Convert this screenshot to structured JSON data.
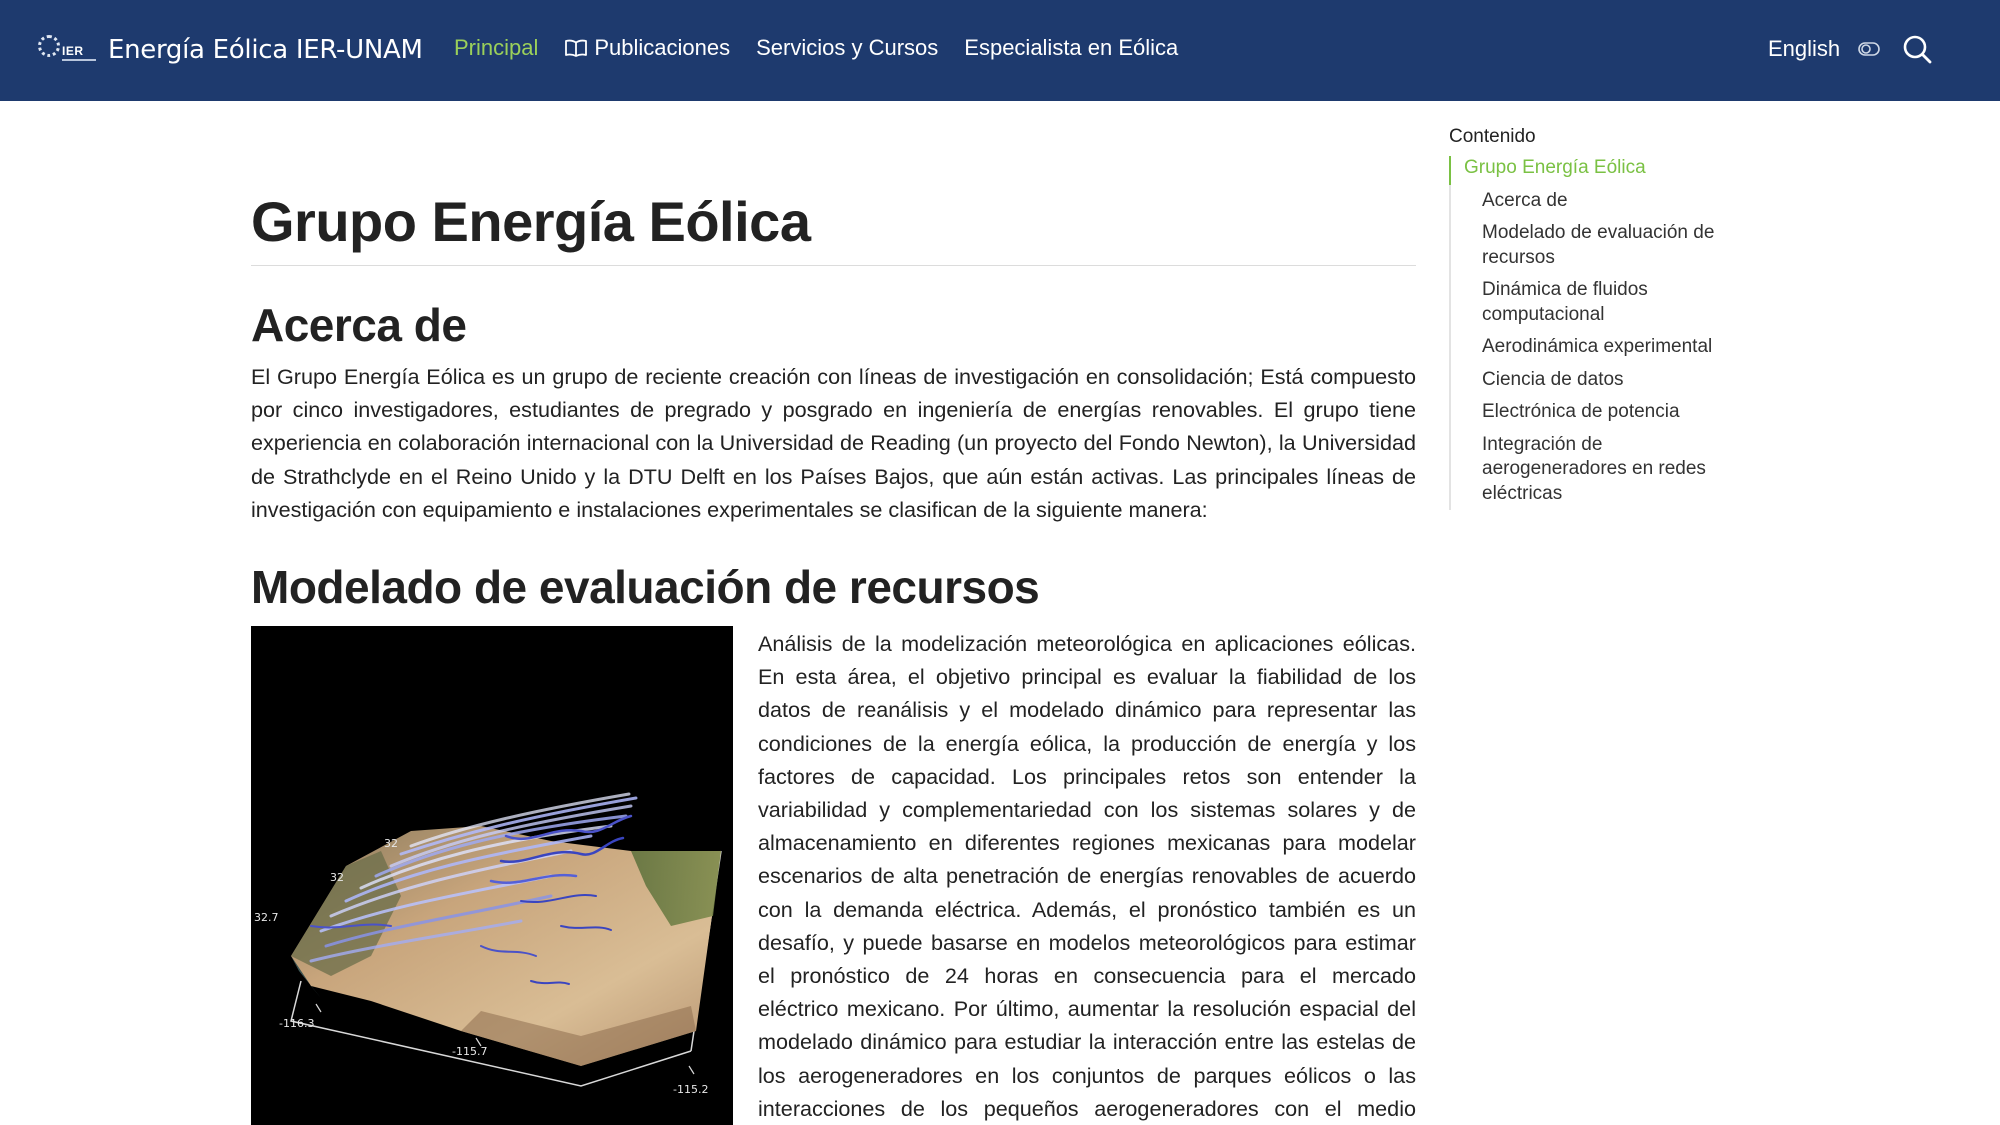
{
  "navbar": {
    "logo_text": "IER",
    "title": "Energía Eólica IER-UNAM",
    "links": [
      {
        "label": "Principal",
        "active": true
      },
      {
        "label": "Publicaciones",
        "icon": "book-icon"
      },
      {
        "label": "Servicios y Cursos"
      },
      {
        "label": "Especialista en Eólica"
      }
    ],
    "language": "English",
    "icons": [
      "theme-toggle-icon",
      "search-icon"
    ],
    "background": "#1e3a6e",
    "active_color": "#9bd05a"
  },
  "main": {
    "title": "Grupo Energía Eólica",
    "acerca": {
      "heading": "Acerca de",
      "text": "El Grupo Energía Eólica es un grupo de reciente creación con líneas de investigación en consolidación; Está compuesto por cinco investigadores, estudiantes de pregrado y posgrado en ingeniería de energías renovables. El grupo tiene experiencia en colaboración internacional con la Universidad de Reading (un proyecto del Fondo Newton), la Universidad de Strathclyde en el Reino Unido y la DTU Delft en los Países Bajos, que aún están activas. Las principales líneas de investigación con equipamiento e instalaciones experimentales se clasifican de la siguiente manera:"
    },
    "modelado": {
      "heading": "Modelado de evaluación de recursos",
      "figure_axis_labels": [
        "32",
        "32",
        "32.7",
        "-116.3",
        "-115.7",
        "-115.2"
      ],
      "text": "Análisis de la modelización meteorológica en aplicaciones eólicas. En esta área, el objetivo principal es evaluar la fiabilidad de los datos de reanálisis y el modelado dinámico para representar las condiciones de la energía eólica, la producción de energía y los factores de capacidad. Los principales retos son entender la variabilidad y complementariedad con los sistemas solares y de almacenamiento en diferentes regiones mexicanas para modelar escenarios de alta penetración de energías renovables de acuerdo con la demanda eléctrica. Además, el pronóstico también es un desafío, y puede basarse en modelos meteorológicos para estimar el pronóstico de 24 horas en consecuencia para el mercado eléctrico mexicano. Por último, aumentar la resolución espacial del modelado dinámico para estudiar la interacción entre las estelas de los aerogeneradores en los conjuntos de parques eólicos o las interacciones de los pequeños aerogeneradores con el medio ambiente."
    }
  },
  "toc": {
    "heading": "Contenido",
    "top": "Grupo Energía Eólica",
    "items": [
      "Acerca de",
      "Modelado de evaluación de recursos",
      "Dinámica de fluidos computacional",
      "Aerodinámica experimental",
      "Ciencia de datos",
      "Electrónica de potencia",
      "Integración de aerogeneradores en redes eléctricas"
    ],
    "accent": "#7ac143"
  }
}
